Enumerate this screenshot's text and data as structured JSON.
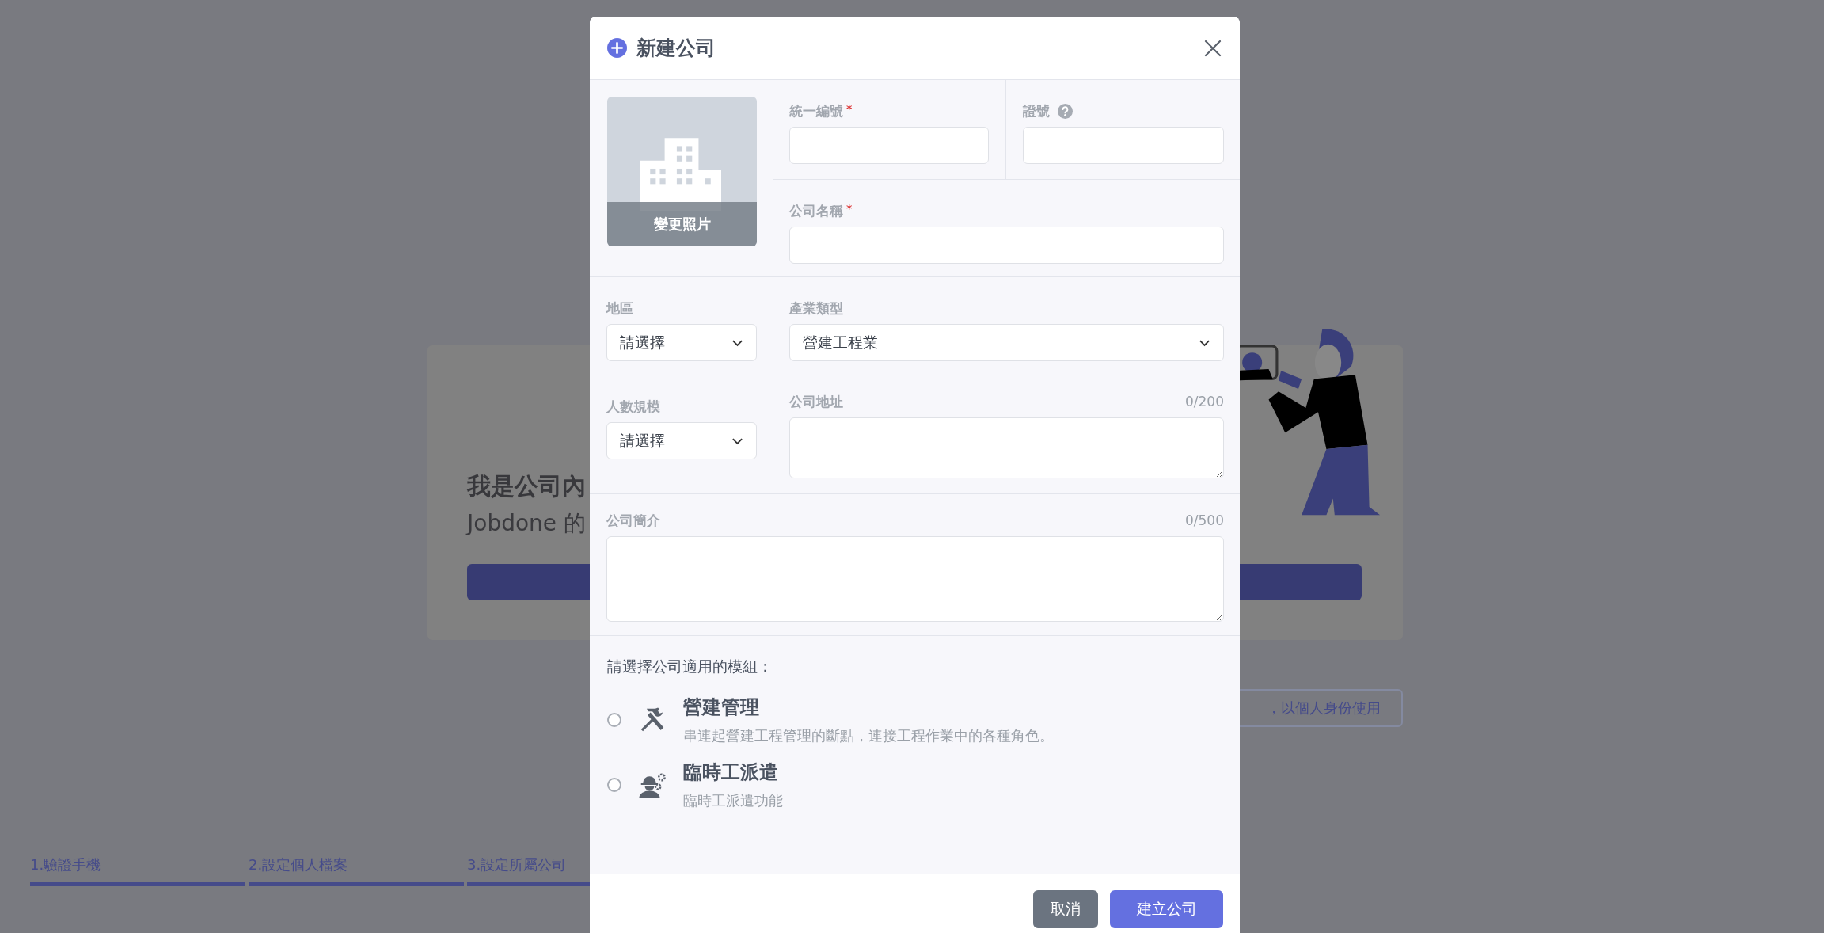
{
  "background": {
    "heading_lines": [
      "我是公司內",
      "Jobdone 的"
    ],
    "personal_button": "，以個人身份使用",
    "steps": [
      {
        "label": "1.驗證手機"
      },
      {
        "label": "2.設定個人檔案"
      },
      {
        "label": "3.設定所屬公司"
      }
    ]
  },
  "dialog": {
    "title": "新建公司",
    "photo_button": "變更照片",
    "tax_id": {
      "label": "統一編號",
      "required_mark": "*"
    },
    "license_no": {
      "label": "證號"
    },
    "company_name": {
      "label": "公司名稱",
      "required_mark": "*"
    },
    "region": {
      "label": "地區",
      "value": "請選擇"
    },
    "industry": {
      "label": "產業類型",
      "value": "營建工程業"
    },
    "headcount": {
      "label": "人數規模",
      "value": "請選擇"
    },
    "address": {
      "label": "公司地址",
      "counter": "0/200"
    },
    "intro": {
      "label": "公司簡介",
      "counter": "0/500"
    },
    "modules": {
      "prompt": "請選擇公司適用的模組：",
      "options": [
        {
          "kind": "tools",
          "title": "營建管理",
          "description": "串連起營建工程管理的斷點，連接工程作業中的各種角色。",
          "selected": false
        },
        {
          "kind": "workers",
          "title": "臨時工派遣",
          "description": "臨時工派遣功能",
          "selected": false
        }
      ]
    },
    "buttons": {
      "cancel": "取消",
      "create": "建立公司"
    }
  }
}
